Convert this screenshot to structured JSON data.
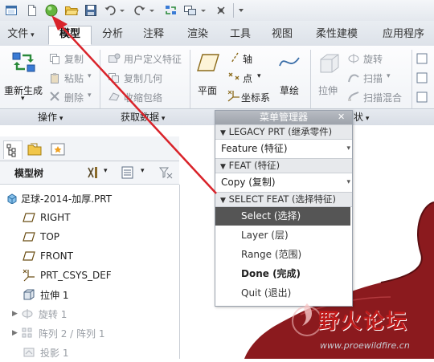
{
  "tabs": [
    "文件",
    "模型",
    "分析",
    "注释",
    "渲染",
    "工具",
    "视图",
    "柔性建模",
    "应用程序"
  ],
  "ribbon": {
    "regenerate": "重新生成",
    "copy": "复制",
    "paste": "粘贴",
    "delete": "删除",
    "user_feature": "用户定义特征",
    "copy_geometry": "复制几何",
    "shrinkwrap": "收缩包络",
    "plane": "平面",
    "axis": "轴",
    "point": "点",
    "csys": "坐标系",
    "sketch": "草绘",
    "extrude": "拉伸",
    "revolve": "旋转",
    "sweep": "扫描",
    "swept_blend": "扫描混合",
    "groups": {
      "operations": "操作",
      "get_data": "获取数据",
      "shapes": "状"
    }
  },
  "navigator": {
    "tree_label": "模型树",
    "items": [
      {
        "label": "足球-2014-加厚.PRT"
      },
      {
        "label": "RIGHT"
      },
      {
        "label": "TOP"
      },
      {
        "label": "FRONT"
      },
      {
        "label": "PRT_CSYS_DEF"
      },
      {
        "label": "拉伸 1"
      },
      {
        "label": "旋转 1"
      },
      {
        "label": "阵列 2 / 阵列 1"
      },
      {
        "label": "投影 1"
      }
    ]
  },
  "menu": {
    "title": "菜单管理器",
    "legacy_head": "LEGACY PRT (继承零件)",
    "legacy_value": "Feature (特征)",
    "feat_head": "FEAT (特征)",
    "feat_value": "Copy (复制)",
    "select_head": "SELECT FEAT (选择特征)",
    "items": [
      "Select (选择)",
      "Layer (层)",
      "Range (范围)",
      "Done (完成)",
      "Quit (退出)"
    ]
  },
  "watermark": {
    "name": "野火论坛",
    "url": "www.proewildfire.cn"
  },
  "colors": {
    "arrow": "#d9232a",
    "part": "#8b1a1e",
    "selected_menu_bg": "#555555"
  }
}
